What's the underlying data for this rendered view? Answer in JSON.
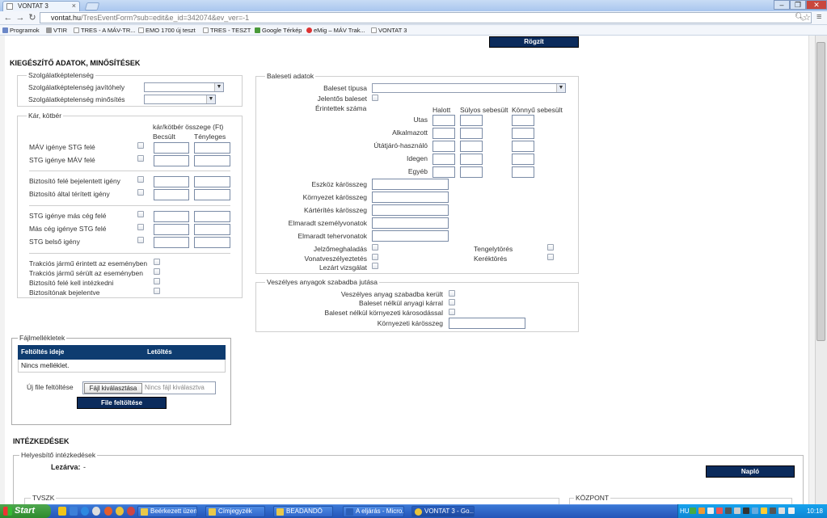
{
  "browser": {
    "tabs": [
      {
        "label": "VONTAT 3"
      }
    ],
    "url_host": "vontat.hu",
    "url_rest": "/TresEventForm?sub=edit&e_id=342074&ev_ver=-1",
    "bookmarks": [
      {
        "label": "Programok"
      },
      {
        "label": "VTIR"
      },
      {
        "label": "TRES - A MÁV-TR..."
      },
      {
        "label": "EMO 1700 új teszt"
      },
      {
        "label": "TRES - TESZT"
      },
      {
        "label": "Google Térkép"
      },
      {
        "label": "eMig – MÁV Trak..."
      },
      {
        "label": "VONTAT 3"
      }
    ],
    "winbtns": {
      "min": "–",
      "max": "❐",
      "close": "✕"
    }
  },
  "form": {
    "save_button": "Rögzít",
    "section_title": "KIEGÉSZÍTŐ ADATOK, MINŐSÍTÉSEK",
    "szolg": {
      "legend": "Szolgálatképtelenség",
      "javitohely": "Szolgálatképtelenség javítóhely",
      "minosites": "Szolgálatképtelenség minősítés"
    },
    "kar": {
      "legend": "Kár, kötbér",
      "header": "kár/kötbér összege (Ft)",
      "col_becsult": "Becsült",
      "col_tenyleges": "Tényleges",
      "rows": [
        "MÁV igénye STG felé",
        "STG igénye MÁV felé",
        "Biztosító felé bejelentett igény",
        "Biztosító által térített igény",
        "STG igénye más cég felé",
        "Más cég igénye STG felé",
        "STG belső igény"
      ],
      "checks": [
        "Trakciós jármű érintett az eseményben",
        "Trakciós jármű sérült az eseményben",
        "Biztosító felé kell intézkedni",
        "Biztosítónak bejelentve"
      ]
    },
    "baleset": {
      "legend": "Baleseti adatok",
      "tipusa": "Baleset típusa",
      "jelentos": "Jelentős baleset",
      "erintettek": "Érintettek száma",
      "cols": [
        "Halott",
        "Súlyos sebesült",
        "Könnyű sebesült"
      ],
      "rows": [
        "Utas",
        "Alkalmazott",
        "Útátjáró-használó",
        "Idegen",
        "Egyéb"
      ],
      "amounts": [
        "Eszköz kárösszeg",
        "Környezet kárösszeg",
        "Kártérítés kárösszeg",
        "Elmaradt személyvonatok",
        "Elmaradt tehervonatok"
      ],
      "checks_left": [
        "Jelzőmeghaladás",
        "Vonatveszélyeztetés",
        "Lezárt vizsgálat"
      ],
      "checks_right": [
        "Tengelytörés",
        "Keréktörés"
      ]
    },
    "veszelyes": {
      "legend": "Veszélyes anyagok szabadba jutása",
      "rows": [
        "Veszélyes anyag szabadba került",
        "Baleset nélkül anyagi kárral",
        "Baleset nélkül környezeti károsodással"
      ],
      "kornyezeti": "Környezeti kárösszeg"
    },
    "fajl": {
      "legend": "Fájlmellékletek",
      "col_ido": "Feltöltés ideje",
      "col_letoltes": "Letöltés",
      "empty": "Nincs melléklet.",
      "upload_label": "Új file feltöltése",
      "choose_button": "Fájl kiválasztása",
      "no_file": "Nincs fájl kiválasztva",
      "upload_button": "File feltöltése"
    },
    "intezkedesek": {
      "title": "INTÉZKEDÉSEK",
      "legend": "Helyesbítő intézkedések",
      "lezarva_label": "Lezárva:",
      "lezarva_value": "-",
      "naplo_button": "Napló",
      "sub_left": "TVSZK",
      "sub_right": "KÖZPONT"
    }
  },
  "taskbar": {
    "start": "Start",
    "tasks": [
      {
        "label": "Beérkezett üzen..."
      },
      {
        "label": "Címjegyzék"
      },
      {
        "label": "BEADANDÓ"
      },
      {
        "label": "A eljárás - Micro..."
      },
      {
        "label": "VONTAT 3 - Go..."
      }
    ],
    "lang": "HU",
    "clock": "10:18"
  },
  "colors": {
    "accent": "#0b2b5c",
    "table_header": "#0e3c70"
  }
}
